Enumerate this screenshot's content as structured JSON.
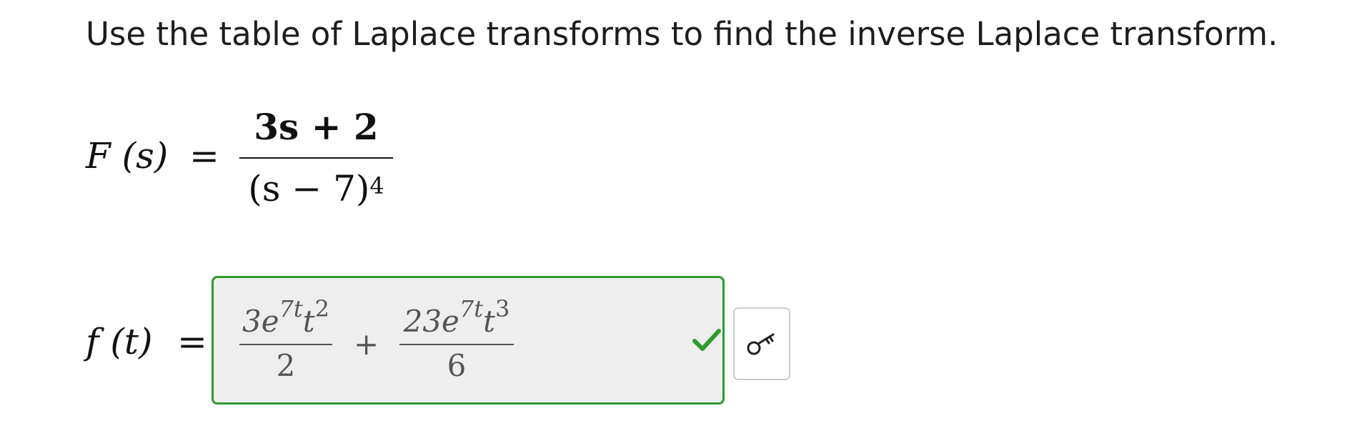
{
  "question": {
    "instruction": "Use the table of Laplace transforms to find the inverse Laplace transform."
  },
  "given": {
    "lhs": "F (s)",
    "equals": "=",
    "numerator": "3s + 2",
    "denominator_base": "(s − 7)",
    "denominator_exponent": "4"
  },
  "answer": {
    "lhs": "f (t)",
    "equals": "=",
    "term1": {
      "coef": "3e",
      "exp": "7t",
      "var": "t",
      "var_exp": "2",
      "den": "2"
    },
    "operator": "+",
    "term2": {
      "coef": "23e",
      "exp": "7t",
      "var": "t",
      "var_exp": "3",
      "den": "6"
    },
    "status": "correct",
    "status_color": "#2e9a2e",
    "status_icon": "check-icon"
  },
  "toolbar": {
    "key_icon": "key-icon"
  }
}
